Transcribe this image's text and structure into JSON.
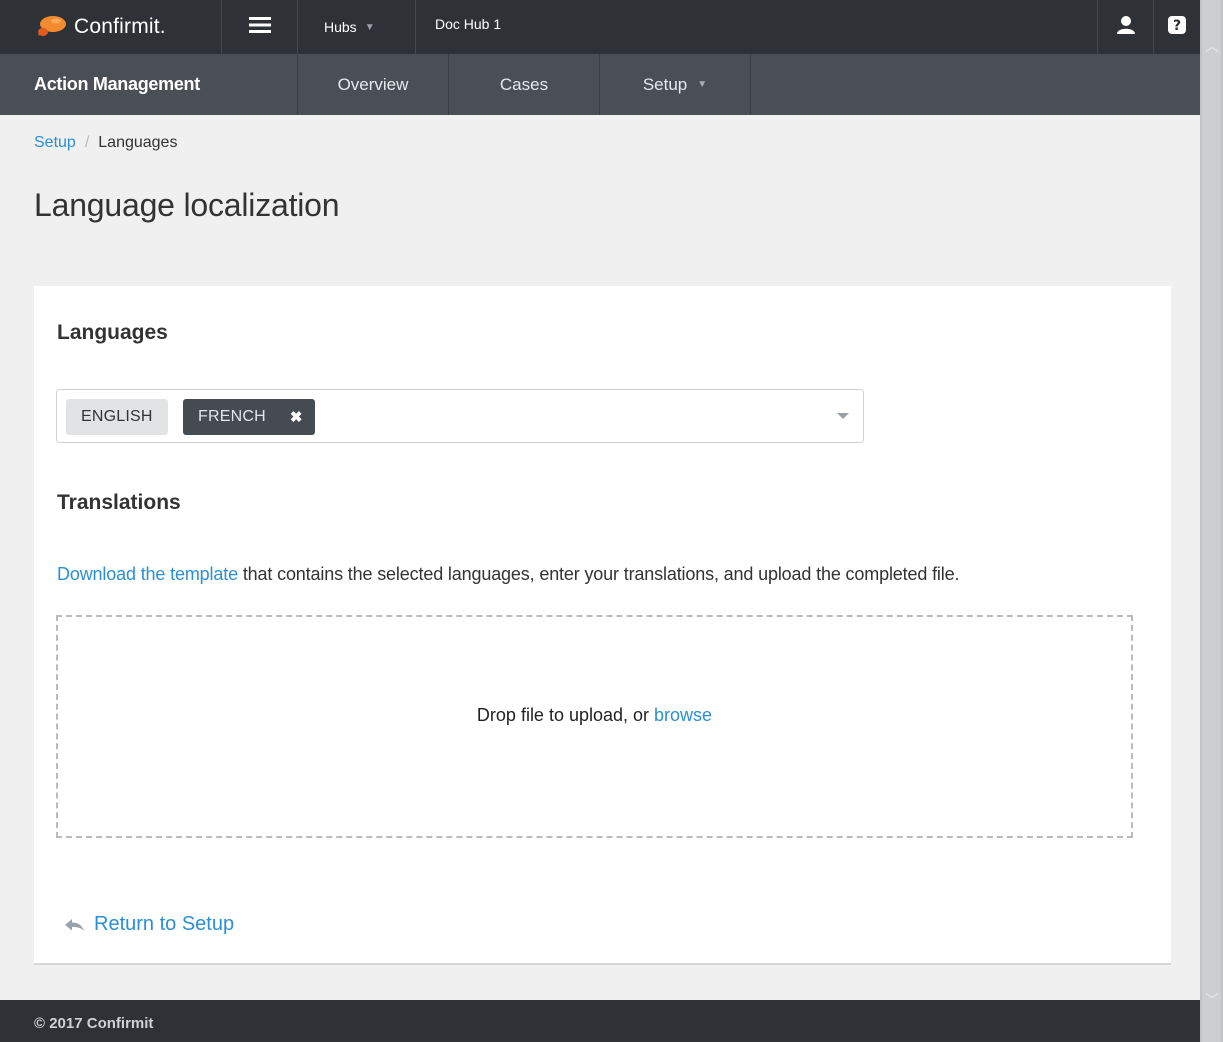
{
  "topbar": {
    "brand": "Confirmit.",
    "hubs_label": "Hubs",
    "current_hub": "Doc Hub 1"
  },
  "subnav": {
    "module": "Action Management",
    "items": [
      {
        "label": "Overview"
      },
      {
        "label": "Cases"
      },
      {
        "label": "Setup",
        "dropdown": true
      }
    ]
  },
  "breadcrumb": {
    "parent": "Setup",
    "current": "Languages"
  },
  "page": {
    "title": "Language localization"
  },
  "languages": {
    "heading": "Languages",
    "selected": [
      "ENGLISH",
      "FRENCH"
    ]
  },
  "translations": {
    "heading": "Translations",
    "download_link": "Download the template",
    "description_rest": " that contains the selected languages, enter your translations, and upload the completed file.",
    "dropzone_text": "Drop file to upload, or ",
    "browse_link": "browse"
  },
  "return_link": "Return to Setup",
  "footer": "© 2017 Confirmit",
  "colors": {
    "topbar": "#2e3136",
    "subnav": "#4a4f56",
    "link": "#2a8fd6",
    "brand_orange": "#f28a2e"
  },
  "icons": [
    "confirmit-logo",
    "menu-icon",
    "user-icon",
    "help-icon",
    "close-icon",
    "chevron-down-icon",
    "reply-arrow-icon"
  ]
}
